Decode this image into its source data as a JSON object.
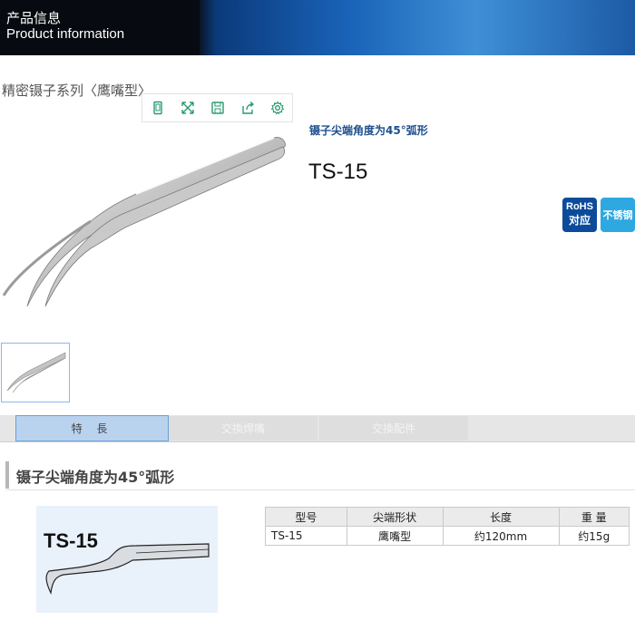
{
  "header": {
    "title_cn": "产品信息",
    "title_en": "Product information"
  },
  "series_title": "精密镊子系列〈鹰嘴型〉",
  "toolbar": {
    "icons": [
      "phone-icon",
      "fullscreen-icon",
      "save-icon",
      "share-icon",
      "settings-icon"
    ]
  },
  "product": {
    "subtitle": "镊子尖端角度为45°弧形",
    "model": "TS-15",
    "badges": {
      "rohs_line1": "RoHS",
      "rohs_line2": "对应",
      "stainless": "不锈钢"
    }
  },
  "tabs": [
    {
      "label": "特 長",
      "active": true
    },
    {
      "label": "交換焊嘴",
      "active": false
    },
    {
      "label": "交換配件",
      "active": false
    }
  ],
  "section": {
    "title": "镊子尖端角度为45°弧形",
    "image_label": "TS-15"
  },
  "spec_table": {
    "headers": [
      "型号",
      "尖端形状",
      "长度",
      "重 量"
    ],
    "rows": [
      [
        "TS-15",
        "鹰嘴型",
        "约120mm",
        "约15g"
      ]
    ]
  },
  "colors": {
    "accent": "#1d4f8e",
    "tab_active": "#b9d2ee",
    "rohs": "#0c4b9a",
    "stainless": "#2ea8e0"
  }
}
